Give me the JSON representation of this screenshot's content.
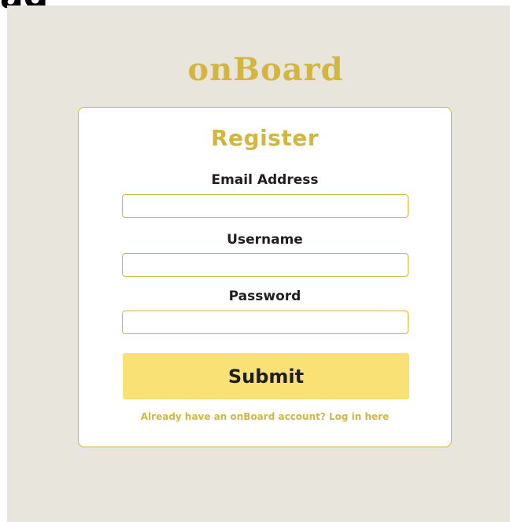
{
  "page": {
    "top_fragment": "ag",
    "logo_text": "onBoard"
  },
  "form": {
    "title": "Register",
    "fields": [
      {
        "label": "Email Address",
        "value": "",
        "placeholder": ""
      },
      {
        "label": "Username",
        "value": "",
        "placeholder": ""
      },
      {
        "label": "Password",
        "value": "",
        "placeholder": ""
      }
    ],
    "submit_label": "Submit",
    "login_prompt": "Already have an onBoard account? Log in here"
  },
  "colors": {
    "accent": "#d3b642",
    "button": "#f9e176",
    "background": "#e8e5dd",
    "text": "#1f1f1f"
  }
}
